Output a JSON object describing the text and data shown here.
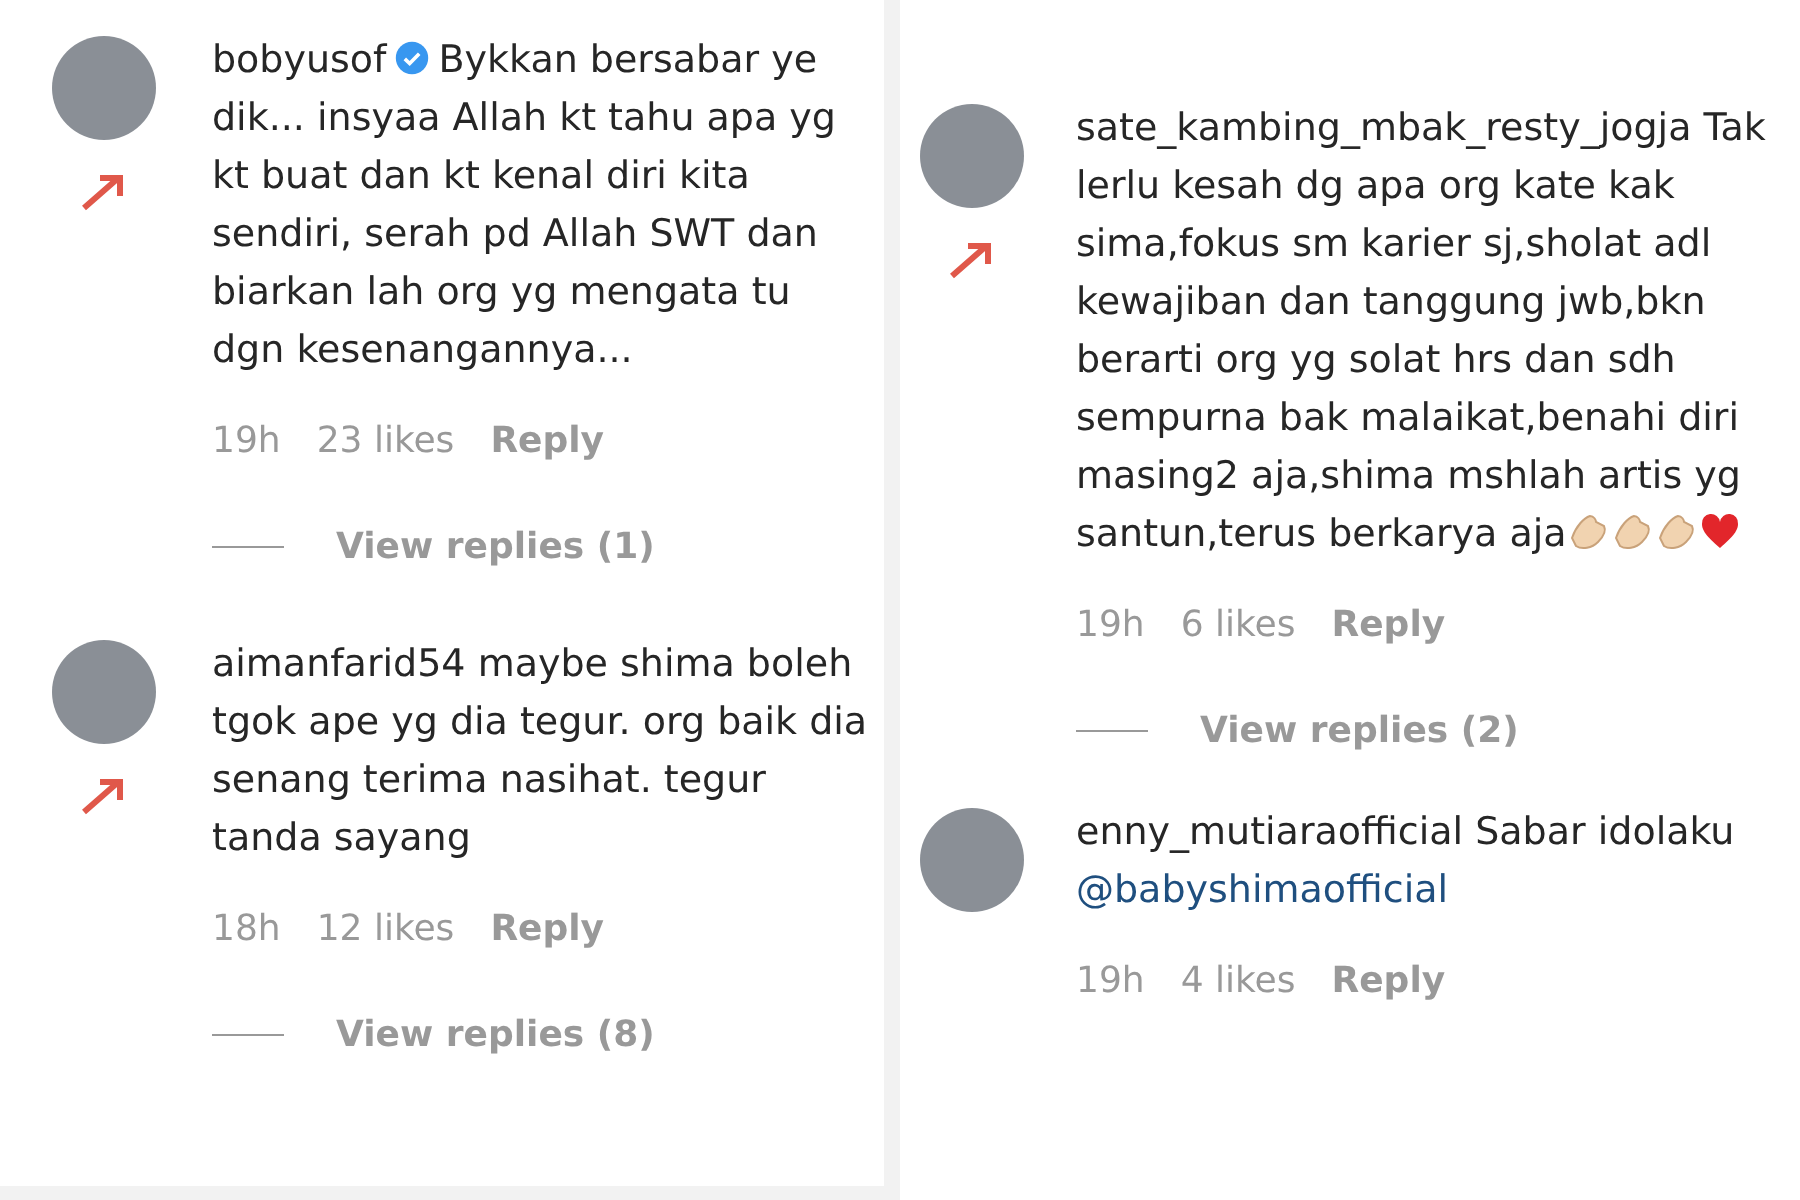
{
  "panels": [
    {
      "comments": [
        {
          "username": "bobyusof",
          "verified": true,
          "text": "Bykkan bersabar ye dik... insyaa Allah kt tahu apa yg kt buat dan kt kenal diri kita sendiri, serah pd Allah SWT dan biarkan lah org yg mengata tu dgn kesenangannya...",
          "time": "19h",
          "likes": "23 likes",
          "reply": "Reply",
          "view_replies": "View replies (1)",
          "arrow": true
        },
        {
          "username": "aimanfarid54",
          "verified": false,
          "text": "maybe shima boleh tgok ape yg dia tegur. org baik dia senang terima nasihat. tegur tanda sayang",
          "time": "18h",
          "likes": "12 likes",
          "reply": "Reply",
          "view_replies": "View replies (8)",
          "arrow": true
        }
      ]
    },
    {
      "comments": [
        {
          "username": "sate_kambing_mbak_resty_jogja",
          "verified": false,
          "text": "Tak lerlu kesah dg apa org kate kak sima,fokus sm karier sj,sholat adl kewajiban dan tanggung jwb,bkn berarti org yg solat hrs dan sdh sempurna bak malaikat,benahi diri masing2 aja,shima mshlah artis yg santun,terus berkarya aja",
          "emoji": [
            {
              "kind": "clap"
            },
            {
              "kind": "clap"
            },
            {
              "kind": "clap"
            },
            {
              "kind": "heart"
            }
          ],
          "time": "19h",
          "likes": "6 likes",
          "reply": "Reply",
          "view_replies": "View replies (2)",
          "arrow": true
        },
        {
          "username": "enny_mutiaraofficial",
          "verified": false,
          "text": "Sabar idolaku",
          "mention": "@babyshimaofficial",
          "time": "19h",
          "likes": "4 likes",
          "reply": "Reply",
          "arrow": false
        }
      ]
    }
  ]
}
